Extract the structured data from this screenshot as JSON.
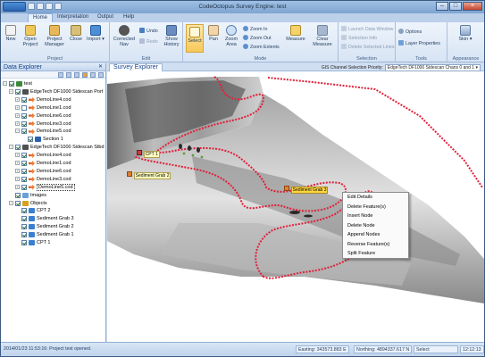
{
  "window": {
    "title": "CodeOctopus Survey Engine: test"
  },
  "tabs": [
    {
      "label": "Home"
    },
    {
      "label": "Interpretation"
    },
    {
      "label": "Output"
    },
    {
      "label": "Help"
    }
  ],
  "ribbon": {
    "project": {
      "label": "Project",
      "new": "New",
      "open": "Open Project",
      "manager": "Project Manager",
      "close": "Close",
      "import": "Import"
    },
    "edit": {
      "label": "Edit",
      "corrected_nav": "Corrected Nav",
      "undo": "Undo",
      "redo": "Redo",
      "show_history": "Show History"
    },
    "mode": {
      "label": "Mode",
      "select": "Select",
      "pan": "Pan",
      "zoom_area": "Zoom Area",
      "zoom_in": "Zoom In",
      "zoom_out": "Zoom Out",
      "zoom_extents": "Zoom Extents",
      "measure": "Measure",
      "clear_measure": "Clear Measure"
    },
    "selection": {
      "label": "Selection",
      "launch": "Launch Data Window",
      "info": "Selection Info",
      "delete_lines": "Delete Selected Lines"
    },
    "tools": {
      "label": "Tools",
      "options": "Options",
      "layer_props": "Layer Properties"
    },
    "appearance": {
      "label": "Appearance",
      "skin": "Skin"
    }
  },
  "explorer": {
    "title": "Data Explorer",
    "items": [
      {
        "label": "test"
      },
      {
        "label": "EdgeTech DF1000 Sidescan Port"
      },
      {
        "label": "DemoLine4.cod"
      },
      {
        "label": "DemoLine1.cod"
      },
      {
        "label": "DemoLine6.cod"
      },
      {
        "label": "DemoLine3.cod"
      },
      {
        "label": "DemoLine5.cod"
      },
      {
        "label": "Section 1"
      },
      {
        "label": "EdgeTech DF1000 Sidescan Stbd"
      },
      {
        "label": "DemoLine4.cod"
      },
      {
        "label": "DemoLine1.cod"
      },
      {
        "label": "DemoLine6.cod"
      },
      {
        "label": "DemoLine3.cod"
      },
      {
        "label": "DemoLine5.cod"
      },
      {
        "label": "Images"
      },
      {
        "label": "Objects"
      },
      {
        "label": "CPT 2"
      },
      {
        "label": "Sediment Grab 3"
      },
      {
        "label": "Sediment Grab 2"
      },
      {
        "label": "Sediment Grab 1"
      },
      {
        "label": "CPT 1"
      }
    ]
  },
  "survey": {
    "tab": "Survey Explorer",
    "channel_label": "GIS Channel Selection Priority:",
    "channel_value": "EdgeTech DF1000 Sidescan Chans 0 and 1",
    "markers": [
      {
        "label": "CPT 1"
      },
      {
        "label": "Sediment Grab 2"
      },
      {
        "label": "Sediment Grab 3"
      }
    ]
  },
  "context_menu": [
    "Edit Details",
    "Delete Feature(s)",
    "Insert Node",
    "Delete Node",
    "Append Nodes",
    "Reverse Feature(s)",
    "Split Feature"
  ],
  "status": {
    "message": "2014/01/23 11:53:16: Project test opened.",
    "easting": "Easting:  343573.883 E",
    "northing": "Northing:  4894337.617 N",
    "mode": "Select",
    "time": "12:12:13"
  }
}
